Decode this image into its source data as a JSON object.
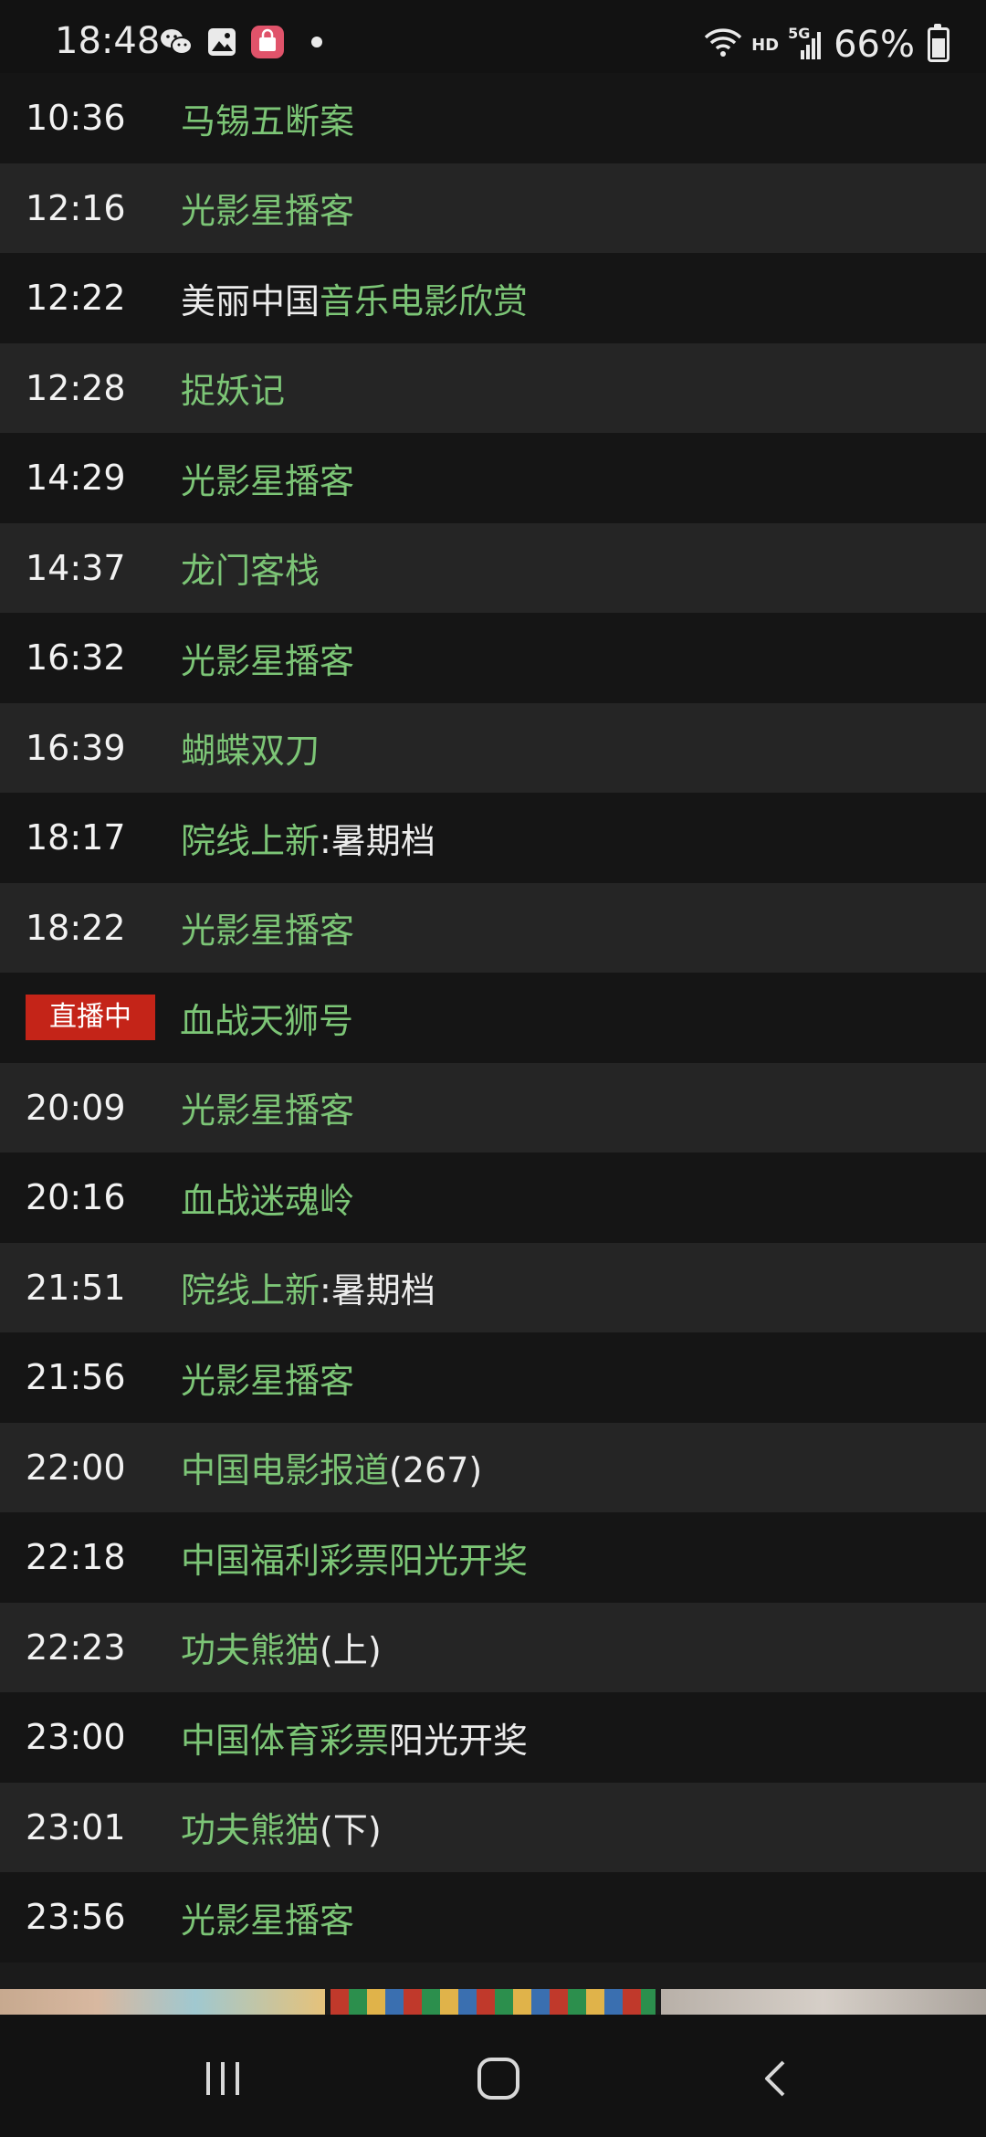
{
  "status_bar": {
    "time": "18:48",
    "left_icons": [
      "wechat-icon",
      "gallery-icon",
      "shopping-bag-icon"
    ],
    "right_icons": [
      "wifi-icon",
      "hd-label",
      "signal-5g-icon",
      "battery-icon"
    ],
    "hd_label": "HD",
    "network_label": "5G",
    "battery": "66%"
  },
  "colors": {
    "program_green": "#7cc576",
    "live_red": "#c42418"
  },
  "live_badge": "直播中",
  "schedule": [
    {
      "time": "10:36",
      "title_green": "马锡五断案",
      "title_white": ""
    },
    {
      "time": "12:16",
      "title_green": "光影星播客",
      "title_white": ""
    },
    {
      "time": "12:22",
      "title_white_pre": "美丽中国",
      "title_green": "音乐电影欣赏",
      "title_white": ""
    },
    {
      "time": "12:28",
      "title_green": "捉妖记",
      "title_white": ""
    },
    {
      "time": "14:29",
      "title_green": "光影星播客",
      "title_white": ""
    },
    {
      "time": "14:37",
      "title_green": "龙门客栈",
      "title_white": ""
    },
    {
      "time": "16:32",
      "title_green": "光影星播客",
      "title_white": ""
    },
    {
      "time": "16:39",
      "title_green": "蝴蝶双刀",
      "title_white": ""
    },
    {
      "time": "18:17",
      "title_green": "院线上新",
      "title_white": ":暑期档"
    },
    {
      "time": "18:22",
      "title_green": "光影星播客",
      "title_white": ""
    },
    {
      "time": "",
      "live": true,
      "title_green": "血战天狮号",
      "title_white": ""
    },
    {
      "time": "20:09",
      "title_green": "光影星播客",
      "title_white": ""
    },
    {
      "time": "20:16",
      "title_green": "血战迷魂岭",
      "title_white": ""
    },
    {
      "time": "21:51",
      "title_green": "院线上新",
      "title_white": ":暑期档"
    },
    {
      "time": "21:56",
      "title_green": "光影星播客",
      "title_white": ""
    },
    {
      "time": "22:00",
      "title_green": "中国电影报道",
      "title_white": "(267)"
    },
    {
      "time": "22:18",
      "title_green": "中国福利彩票阳光开奖",
      "title_white": ""
    },
    {
      "time": "22:23",
      "title_green": "功夫熊猫",
      "title_white": "(上)"
    },
    {
      "time": "23:00",
      "title_green": "中国体育彩票",
      "title_white": "阳光开奖"
    },
    {
      "time": "23:01",
      "title_green": "功夫熊猫",
      "title_white": "(下)"
    },
    {
      "time": "23:56",
      "title_green": "光影星播客",
      "title_white": ""
    }
  ],
  "nav_bar": {
    "buttons": [
      "recent-apps-icon",
      "home-icon",
      "back-icon"
    ]
  }
}
